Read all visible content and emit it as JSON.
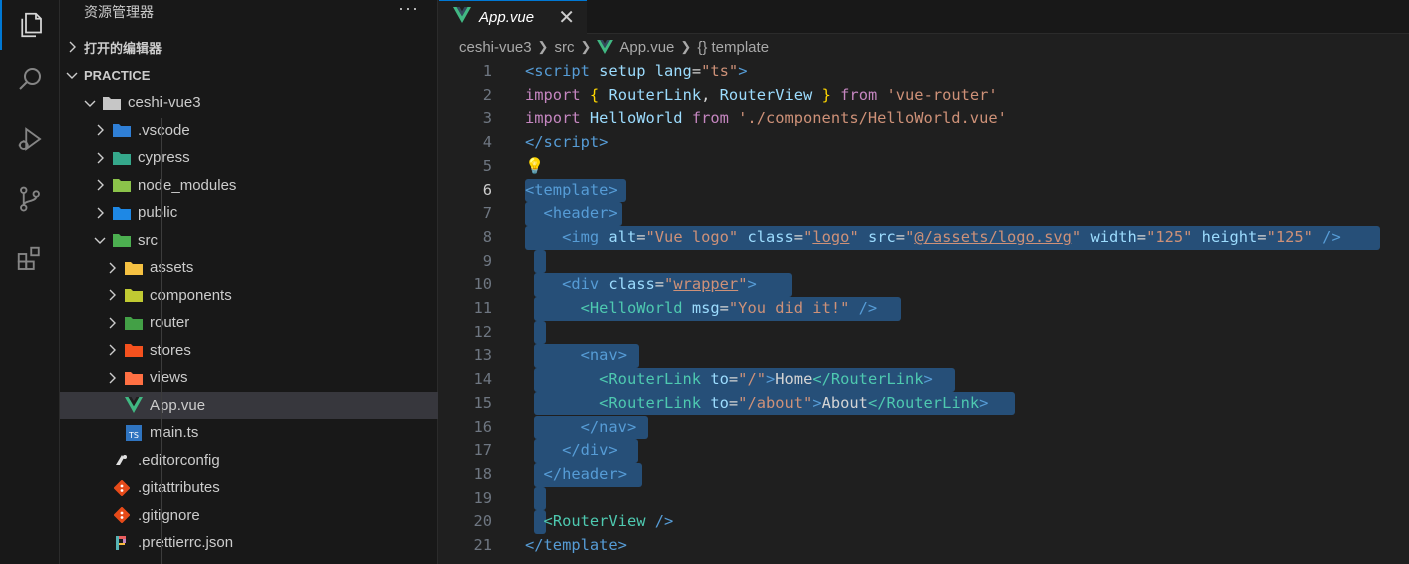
{
  "explorer": {
    "title": "资源管理器",
    "more": "···",
    "open_editors": "打开的编辑器",
    "workspace": "PRACTICE",
    "tree": [
      {
        "label": "ceshi-vue3",
        "depth": 1,
        "chevron": "down",
        "icon": "folder-open-icon"
      },
      {
        "label": ".vscode",
        "depth": 2,
        "chevron": "right",
        "icon": "vscode-folder-icon"
      },
      {
        "label": "cypress",
        "depth": 2,
        "chevron": "right",
        "icon": "cypress-folder-icon"
      },
      {
        "label": "node_modules",
        "depth": 2,
        "chevron": "right",
        "icon": "node-folder-icon"
      },
      {
        "label": "public",
        "depth": 2,
        "chevron": "right",
        "icon": "public-folder-icon"
      },
      {
        "label": "src",
        "depth": 2,
        "chevron": "down",
        "icon": "src-folder-icon"
      },
      {
        "label": "assets",
        "depth": 3,
        "chevron": "right",
        "icon": "assets-folder-icon"
      },
      {
        "label": "components",
        "depth": 3,
        "chevron": "right",
        "icon": "components-folder-icon"
      },
      {
        "label": "router",
        "depth": 3,
        "chevron": "right",
        "icon": "router-folder-icon"
      },
      {
        "label": "stores",
        "depth": 3,
        "chevron": "right",
        "icon": "stores-folder-icon"
      },
      {
        "label": "views",
        "depth": 3,
        "chevron": "right",
        "icon": "views-folder-icon"
      },
      {
        "label": "App.vue",
        "depth": 3,
        "chevron": "",
        "icon": "vue-file-icon",
        "selected": true
      },
      {
        "label": "main.ts",
        "depth": 3,
        "chevron": "",
        "icon": "ts-file-icon"
      },
      {
        "label": ".editorconfig",
        "depth": 2,
        "chevron": "",
        "icon": "editorconfig-file-icon"
      },
      {
        "label": ".gitattributes",
        "depth": 2,
        "chevron": "",
        "icon": "git-file-icon"
      },
      {
        "label": ".gitignore",
        "depth": 2,
        "chevron": "",
        "icon": "git-file-icon"
      },
      {
        "label": ".prettierrc.json",
        "depth": 2,
        "chevron": "",
        "icon": "prettier-file-icon"
      }
    ]
  },
  "tab": {
    "label": "App.vue",
    "close": "✕"
  },
  "breadcrumb": [
    "ceshi-vue3",
    "src",
    "App.vue",
    "{} template"
  ],
  "code": [
    {
      "n": "1",
      "tokens": [
        [
          "tag",
          "<script"
        ],
        [
          "attr",
          " setup"
        ],
        [
          "attr",
          " lang"
        ],
        [
          "txt",
          "="
        ],
        [
          "str",
          "\"ts\""
        ],
        [
          "tag",
          ">"
        ]
      ]
    },
    {
      "n": "2",
      "tokens": [
        [
          "kw",
          "import"
        ],
        [
          "txt",
          " "
        ],
        [
          "br",
          "{"
        ],
        [
          "attr",
          " RouterLink"
        ],
        [
          "txt",
          ","
        ],
        [
          "attr",
          " RouterView"
        ],
        [
          "txt",
          " "
        ],
        [
          "br",
          "}"
        ],
        [
          "kw",
          " from"
        ],
        [
          "str",
          " 'vue-router'"
        ]
      ]
    },
    {
      "n": "3",
      "tokens": [
        [
          "kw",
          "import"
        ],
        [
          "attr",
          " HelloWorld"
        ],
        [
          "kw",
          " from"
        ],
        [
          "str",
          " './components/HelloWorld.vue'"
        ]
      ]
    },
    {
      "n": "4",
      "tokens": [
        [
          "tag",
          "</script"
        ],
        [
          "tag",
          ">"
        ]
      ]
    },
    {
      "n": "5",
      "tokens": [
        [
          "txt",
          "💡"
        ]
      ]
    },
    {
      "n": "6",
      "tokens": [
        [
          "tag",
          "<template"
        ],
        [
          "tag",
          ">"
        ]
      ]
    },
    {
      "n": "7",
      "tokens": [
        [
          "txt",
          "  "
        ],
        [
          "tag",
          "<header"
        ],
        [
          "tag",
          ">"
        ]
      ]
    },
    {
      "n": "8",
      "tokens": [
        [
          "txt",
          "    "
        ],
        [
          "tag",
          "<img"
        ],
        [
          "attr",
          " alt"
        ],
        [
          "txt",
          "="
        ],
        [
          "str",
          "\"Vue logo\""
        ],
        [
          "attr",
          " class"
        ],
        [
          "txt",
          "="
        ],
        [
          "str",
          "\""
        ],
        [
          "stru",
          "logo"
        ],
        [
          "str",
          "\""
        ],
        [
          "attr",
          " src"
        ],
        [
          "txt",
          "="
        ],
        [
          "str",
          "\""
        ],
        [
          "stru",
          "@/assets/logo.svg"
        ],
        [
          "str",
          "\""
        ],
        [
          "attr",
          " width"
        ],
        [
          "txt",
          "="
        ],
        [
          "str",
          "\"125\""
        ],
        [
          "attr",
          " height"
        ],
        [
          "txt",
          "="
        ],
        [
          "str",
          "\"125\""
        ],
        [
          "tag",
          " />"
        ]
      ]
    },
    {
      "n": "9",
      "tokens": [
        [
          "txt",
          " "
        ]
      ]
    },
    {
      "n": "10",
      "tokens": [
        [
          "txt",
          "    "
        ],
        [
          "tag",
          "<div"
        ],
        [
          "attr",
          " class"
        ],
        [
          "txt",
          "="
        ],
        [
          "str",
          "\""
        ],
        [
          "stru",
          "wrapper"
        ],
        [
          "str",
          "\""
        ],
        [
          "tag",
          ">"
        ]
      ]
    },
    {
      "n": "11",
      "tokens": [
        [
          "txt",
          "      "
        ],
        [
          "vue",
          "<HelloWorld"
        ],
        [
          "attr",
          " msg"
        ],
        [
          "txt",
          "="
        ],
        [
          "str",
          "\"You did it!\""
        ],
        [
          "tag",
          " />"
        ]
      ]
    },
    {
      "n": "12",
      "tokens": [
        [
          "txt",
          " "
        ]
      ]
    },
    {
      "n": "13",
      "tokens": [
        [
          "txt",
          "      "
        ],
        [
          "tag",
          "<nav"
        ],
        [
          "tag",
          ">"
        ]
      ]
    },
    {
      "n": "14",
      "tokens": [
        [
          "txt",
          "        "
        ],
        [
          "vue",
          "<RouterLink"
        ],
        [
          "attr",
          " to"
        ],
        [
          "txt",
          "="
        ],
        [
          "str",
          "\"/\""
        ],
        [
          "tag",
          ">"
        ],
        [
          "txt",
          "Home"
        ],
        [
          "vue",
          "</RouterLink"
        ],
        [
          "tag",
          ">"
        ]
      ]
    },
    {
      "n": "15",
      "tokens": [
        [
          "txt",
          "        "
        ],
        [
          "vue",
          "<RouterLink"
        ],
        [
          "attr",
          " to"
        ],
        [
          "txt",
          "="
        ],
        [
          "str",
          "\"/about\""
        ],
        [
          "tag",
          ">"
        ],
        [
          "txt",
          "About"
        ],
        [
          "vue",
          "</RouterLink"
        ],
        [
          "tag",
          ">"
        ]
      ]
    },
    {
      "n": "16",
      "tokens": [
        [
          "txt",
          "      "
        ],
        [
          "tag",
          "</nav"
        ],
        [
          "tag",
          ">"
        ]
      ]
    },
    {
      "n": "17",
      "tokens": [
        [
          "txt",
          "    "
        ],
        [
          "tag",
          "</div"
        ],
        [
          "tag",
          ">"
        ]
      ]
    },
    {
      "n": "18",
      "tokens": [
        [
          "txt",
          "  "
        ],
        [
          "tag",
          "</header"
        ],
        [
          "tag",
          ">"
        ]
      ]
    },
    {
      "n": "19",
      "tokens": [
        [
          "txt",
          " "
        ]
      ]
    },
    {
      "n": "20",
      "tokens": [
        [
          "txt",
          "  "
        ],
        [
          "vue",
          "<RouterView"
        ],
        [
          "tag",
          " />"
        ]
      ]
    },
    {
      "n": "21",
      "tokens": [
        [
          "tag",
          "</template"
        ],
        [
          "tag",
          ">"
        ]
      ]
    }
  ],
  "colors": {
    "accent": "#0078d4",
    "selection": "#264f78",
    "vue": "#41b883"
  }
}
